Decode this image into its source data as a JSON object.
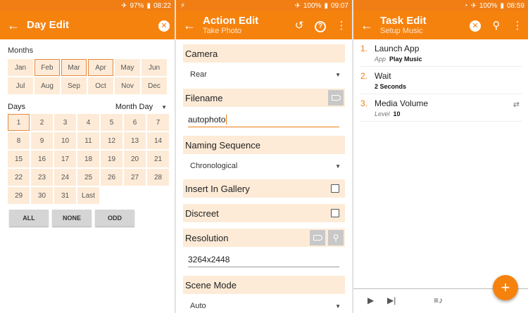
{
  "colors": {
    "primary": "#f6820e",
    "status": "#f07e14",
    "cell_bg": "#fdebd7"
  },
  "panel1": {
    "status": {
      "battery": "97%",
      "time": "08:22"
    },
    "title": "Day Edit",
    "months_label": "Months",
    "months": [
      "Jan",
      "Feb",
      "Mar",
      "Apr",
      "May",
      "Jun",
      "Jul",
      "Aug",
      "Sep",
      "Oct",
      "Nov",
      "Dec"
    ],
    "selected_months": [
      "Feb",
      "Mar",
      "Apr"
    ],
    "days_label": "Days",
    "day_mode": "Month Day",
    "days": [
      "1",
      "2",
      "3",
      "4",
      "5",
      "6",
      "7",
      "8",
      "9",
      "10",
      "11",
      "12",
      "13",
      "14",
      "15",
      "16",
      "17",
      "18",
      "19",
      "20",
      "21",
      "22",
      "23",
      "24",
      "25",
      "26",
      "27",
      "28",
      "29",
      "30",
      "31",
      "Last"
    ],
    "selected_days": [
      "1"
    ],
    "buttons": {
      "all": "ALL",
      "none": "NONE",
      "odd": "ODD"
    }
  },
  "panel2": {
    "status": {
      "battery": "100%",
      "time": "09:07"
    },
    "title": "Action Edit",
    "subtitle": "Take Photo",
    "camera": {
      "label": "Camera",
      "value": "Rear"
    },
    "filename": {
      "label": "Filename",
      "value": "autophoto"
    },
    "naming": {
      "label": "Naming Sequence",
      "value": "Chronological"
    },
    "gallery": {
      "label": "Insert In Gallery"
    },
    "discreet": {
      "label": "Discreet"
    },
    "resolution": {
      "label": "Resolution",
      "value": "3264x2448"
    },
    "scene": {
      "label": "Scene Mode",
      "value": "Auto"
    }
  },
  "panel3": {
    "status": {
      "battery": "100%",
      "time": "08:59"
    },
    "title": "Task Edit",
    "subtitle": "Setup Music",
    "tasks": [
      {
        "num": "1.",
        "name": "Launch App",
        "arg_key": "App",
        "arg_val": "Play Music"
      },
      {
        "num": "2.",
        "name": "Wait",
        "arg_key": "",
        "arg_val": "2 Seconds"
      },
      {
        "num": "3.",
        "name": "Media Volume",
        "arg_key": "Level",
        "arg_val": "10"
      }
    ]
  }
}
